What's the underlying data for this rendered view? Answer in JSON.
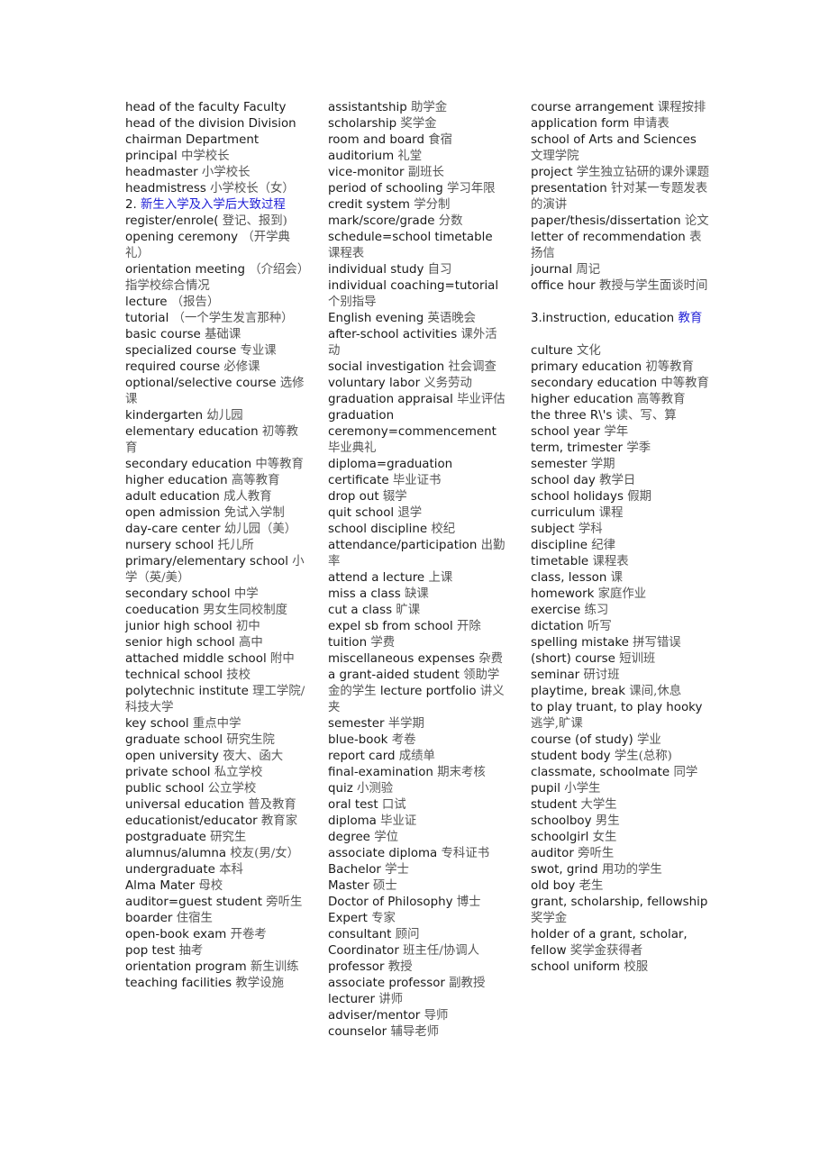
{
  "columns": [
    {
      "entries": [
        {
          "en": "head of the faculty Faculty",
          "zh": ""
        },
        {
          "en": "head of the division Division",
          "zh": ""
        },
        {
          "en": "chairman Department",
          "zh": ""
        },
        {
          "en": "principal",
          "zh": "中学校长"
        },
        {
          "en": "headmaster",
          "zh": "小学校长"
        },
        {
          "en": "headmistress",
          "zh": "小学校长（女）"
        },
        {
          "en": "2.",
          "zh": "新生入学及入学后大致过程",
          "heading": true
        },
        {
          "en": "register/enrole(",
          "zh": "登记、报到)"
        },
        {
          "en": "opening ceremony",
          "zh": "（开学典礼）"
        },
        {
          "en": "orientation meeting",
          "zh": "（介绍会）指学校综合情况"
        },
        {
          "en": "lecture",
          "zh": "（报告）"
        },
        {
          "en": "tutorial",
          "zh": "（一个学生发言那种）"
        },
        {
          "en": "basic course",
          "zh": "基础课"
        },
        {
          "en": "specialized course",
          "zh": "专业课"
        },
        {
          "en": "required course",
          "zh": "必修课"
        },
        {
          "en": "optional/selective course",
          "zh": "选修课"
        },
        {
          "en": "kindergarten",
          "zh": "幼儿园"
        },
        {
          "en": "elementary education",
          "zh": "初等教育"
        },
        {
          "en": "secondary education",
          "zh": "中等教育"
        },
        {
          "en": "higher education",
          "zh": "高等教育"
        },
        {
          "en": "adult education",
          "zh": "成人教育"
        },
        {
          "en": "open admission",
          "zh": "免试入学制"
        },
        {
          "en": "day-care center",
          "zh": "幼儿园（美）"
        },
        {
          "en": "nursery school",
          "zh": "托儿所"
        },
        {
          "en": "primary/elementary school",
          "zh": "小学（英/美）"
        },
        {
          "en": "secondary school",
          "zh": "中学"
        },
        {
          "en": "coeducation",
          "zh": "男女生同校制度"
        },
        {
          "en": "junior high school",
          "zh": "初中"
        },
        {
          "en": "senior high school",
          "zh": "高中"
        },
        {
          "en": "attached middle school",
          "zh": "附中"
        },
        {
          "en": "technical school",
          "zh": "技校"
        },
        {
          "en": "polytechnic institute",
          "zh": "理工学院/科技大学"
        },
        {
          "en": "key school",
          "zh": "重点中学"
        },
        {
          "en": "graduate school",
          "zh": "研究生院"
        },
        {
          "en": "open university",
          "zh": "夜大、函大"
        },
        {
          "en": "private school",
          "zh": "私立学校"
        },
        {
          "en": "public school",
          "zh": "公立学校"
        },
        {
          "en": "universal education",
          "zh": "普及教育"
        },
        {
          "en": "educationist/educator",
          "zh": "教育家"
        },
        {
          "en": "postgraduate",
          "zh": "研究生"
        },
        {
          "en": "alumnus/alumna",
          "zh": "校友(男/女）"
        },
        {
          "en": "undergraduate",
          "zh": "本科"
        },
        {
          "en": "Alma Mater",
          "zh": "母校"
        },
        {
          "en": "auditor=guest student",
          "zh": "旁听生"
        },
        {
          "en": "boarder",
          "zh": "住宿生"
        },
        {
          "en": "open-book exam",
          "zh": "开卷考"
        },
        {
          "en": "pop test",
          "zh": "抽考"
        },
        {
          "en": "orientation program",
          "zh": "新生训练"
        },
        {
          "en": "teaching facilities",
          "zh": "教学设施"
        }
      ]
    },
    {
      "entries": [
        {
          "en": "assistantship",
          "zh": "助学金"
        },
        {
          "en": "scholarship",
          "zh": "奖学金"
        },
        {
          "en": "room and board",
          "zh": "食宿"
        },
        {
          "en": "auditorium",
          "zh": "礼堂"
        },
        {
          "en": "vice-monitor",
          "zh": "副班长"
        },
        {
          "en": "period of schooling",
          "zh": "学习年限"
        },
        {
          "en": "credit system",
          "zh": "学分制"
        },
        {
          "en": "mark/score/grade",
          "zh": "分数"
        },
        {
          "en": "schedule=school timetable",
          "zh": "课程表"
        },
        {
          "en": "individual study",
          "zh": "自习"
        },
        {
          "en": "individual coaching=tutorial",
          "zh": "个别指导"
        },
        {
          "en": "English evening",
          "zh": "英语晚会"
        },
        {
          "en": "after-school activities",
          "zh": "课外活动"
        },
        {
          "en": "social investigation",
          "zh": "社会调查"
        },
        {
          "en": "voluntary labor",
          "zh": "义务劳动"
        },
        {
          "en": "graduation appraisal",
          "zh": "毕业评估"
        },
        {
          "en": "graduation ceremony=commencement",
          "zh": "毕业典礼"
        },
        {
          "en": "diploma=graduation certificate",
          "zh": "毕业证书"
        },
        {
          "en": "drop out",
          "zh": "辍学"
        },
        {
          "en": "quit school",
          "zh": "退学"
        },
        {
          "en": "school discipline",
          "zh": "校纪"
        },
        {
          "en": "attendance/participation",
          "zh": "出勤率"
        },
        {
          "en": "attend a lecture",
          "zh": "上课"
        },
        {
          "en": "miss a class",
          "zh": "缺课"
        },
        {
          "en": "cut a class",
          "zh": "旷课"
        },
        {
          "en": "expel sb from school",
          "zh": "开除"
        },
        {
          "en": "tuition",
          "zh": "学费"
        },
        {
          "en": "miscellaneous expenses",
          "zh": "杂费"
        },
        {
          "en": "a grant-aided student",
          "zh": "领助学金的学生",
          "tail_en": "lecture portfolio",
          "tail_zh": "讲义夹"
        },
        {
          "en": "semester",
          "zh": "半学期"
        },
        {
          "en": "blue-book",
          "zh": "考卷"
        },
        {
          "en": "report card",
          "zh": "成绩单"
        },
        {
          "en": "final-examination",
          "zh": "期末考核"
        },
        {
          "en": "quiz",
          "zh": "小测验"
        },
        {
          "en": "oral test",
          "zh": "口试"
        },
        {
          "en": "diploma",
          "zh": "毕业证"
        },
        {
          "en": "degree",
          "zh": "学位"
        },
        {
          "en": "associate diploma",
          "zh": "专科证书"
        },
        {
          "en": "Bachelor",
          "zh": "学士"
        },
        {
          "en": "Master",
          "zh": "硕士"
        },
        {
          "en": "Doctor of Philosophy",
          "zh": "博士"
        },
        {
          "en": "Expert",
          "zh": "专家"
        },
        {
          "en": "consultant",
          "zh": "顾问"
        },
        {
          "en": "Coordinator",
          "zh": "班主任/协调人"
        },
        {
          "en": "professor",
          "zh": "教授"
        },
        {
          "en": "associate professor",
          "zh": "副教授"
        },
        {
          "en": "lecturer",
          "zh": "讲师"
        },
        {
          "en": "adviser/mentor",
          "zh": "导师"
        },
        {
          "en": "counselor",
          "zh": "辅导老师"
        }
      ]
    },
    {
      "entries": [
        {
          "en": "course arrangement",
          "zh": "课程按排"
        },
        {
          "en": "application form",
          "zh": "申请表"
        },
        {
          "en": "school of Arts and Sciences",
          "zh": "文理学院"
        },
        {
          "en": "project",
          "zh": "学生独立钻研的课外课题"
        },
        {
          "en": "presentation",
          "zh": "针对某一专题发表的演讲"
        },
        {
          "en": "paper/thesis/dissertation",
          "zh": "论文"
        },
        {
          "en": "letter of recommendation",
          "zh": "表扬信"
        },
        {
          "en": "journal",
          "zh": "周记"
        },
        {
          "en": "office hour",
          "zh": "教授与学生面谈时间"
        },
        {
          "spacer": true
        },
        {
          "en": "3.instruction, education",
          "zh": "教育",
          "heading": true
        },
        {
          "spacer": true
        },
        {
          "en": "culture",
          "zh": " 文化"
        },
        {
          "en": "primary education",
          "zh": " 初等教育"
        },
        {
          "en": "secondary education",
          "zh": " 中等教育"
        },
        {
          "en": "higher education",
          "zh": " 高等教育"
        },
        {
          "en": "the three R\\'s",
          "zh": " 读、写、算"
        },
        {
          "en": "school year",
          "zh": " 学年"
        },
        {
          "en": "term, trimester",
          "zh": " 学季"
        },
        {
          "en": "semester",
          "zh": " 学期"
        },
        {
          "en": "school day",
          "zh": " 教学日"
        },
        {
          "en": "school holidays",
          "zh": " 假期"
        },
        {
          "en": "curriculum",
          "zh": " 课程"
        },
        {
          "en": "subject",
          "zh": " 学科"
        },
        {
          "en": "discipline",
          "zh": " 纪律"
        },
        {
          "en": "timetable",
          "zh": " 课程表"
        },
        {
          "en": "class, lesson",
          "zh": " 课"
        },
        {
          "en": "homework",
          "zh": " 家庭作业"
        },
        {
          "en": "exercise",
          "zh": " 练习"
        },
        {
          "en": "dictation",
          "zh": " 听写"
        },
        {
          "en": "spelling mistake",
          "zh": " 拼写错误"
        },
        {
          "en": "(short) course",
          "zh": " 短训班"
        },
        {
          "en": "seminar",
          "zh": " 研讨班"
        },
        {
          "en": "playtime, break",
          "zh": " 课间,休息"
        },
        {
          "en": "to play truant, to play hooky",
          "zh": " 逃学,旷课"
        },
        {
          "en": "course (of study)",
          "zh": " 学业"
        },
        {
          "en": "student body",
          "zh": " 学生(总称)"
        },
        {
          "en": "classmate, schoolmate",
          "zh": " 同学"
        },
        {
          "en": "pupil",
          "zh": " 小学生"
        },
        {
          "en": "student",
          "zh": " 大学生"
        },
        {
          "en": "schoolboy",
          "zh": " 男生"
        },
        {
          "en": "schoolgirl",
          "zh": " 女生"
        },
        {
          "en": "auditor",
          "zh": " 旁听生"
        },
        {
          "en": "swot, grind",
          "zh": " 用功的学生"
        },
        {
          "en": "old boy",
          "zh": " 老生"
        },
        {
          "en": "grant, scholarship, fellowship",
          "zh": " 奖学金"
        },
        {
          "en": "holder of a grant, scholar, fellow",
          "zh": " 奖学金获得者"
        },
        {
          "en": "school uniform",
          "zh": " 校服"
        }
      ]
    }
  ]
}
